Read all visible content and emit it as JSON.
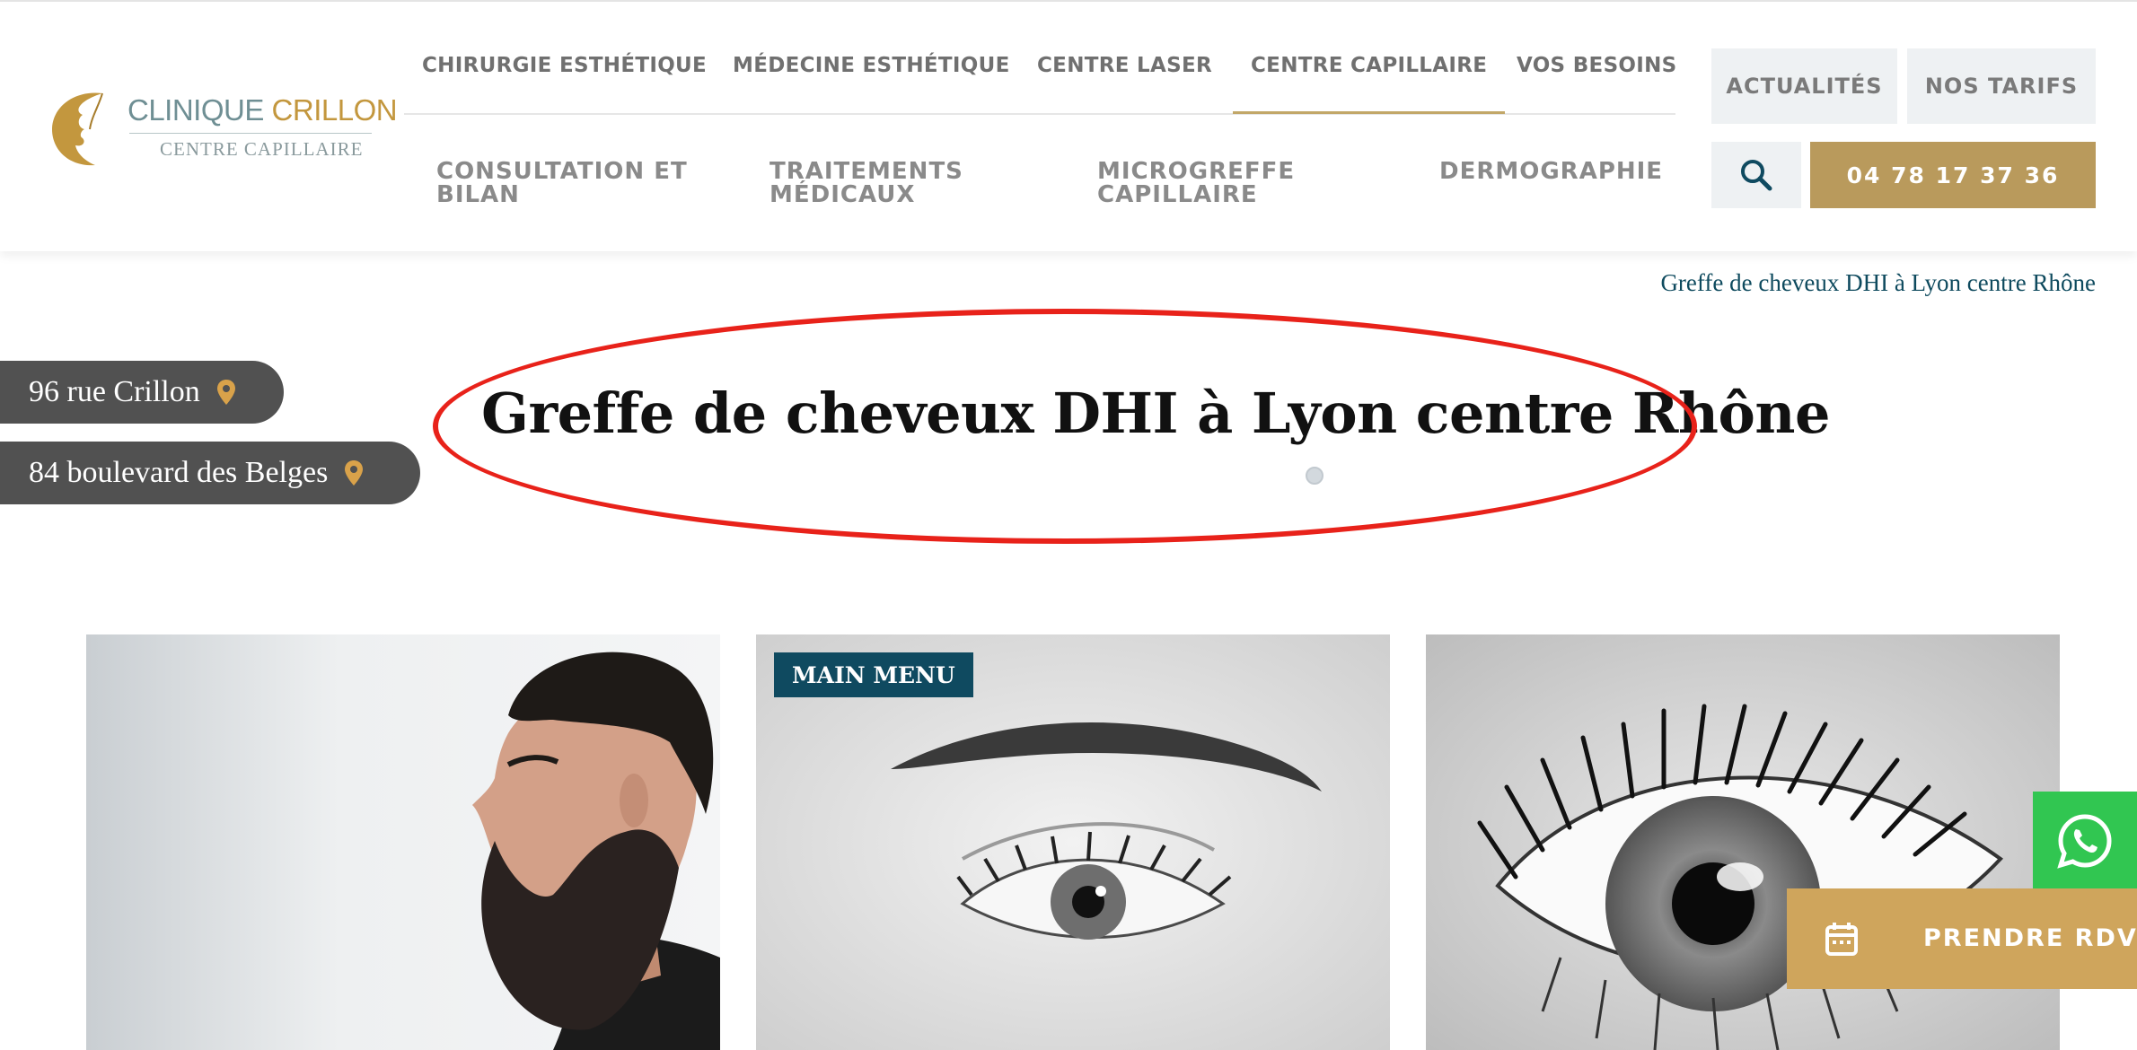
{
  "logo": {
    "name_part1": "CLINIQUE ",
    "name_part2": "CRILLON",
    "subtitle": "CENTRE CAPILLAIRE"
  },
  "nav_top": [
    {
      "label": "CHIRURGIE ESTHÉTIQUE"
    },
    {
      "label": "MÉDECINE ESTHÉTIQUE"
    },
    {
      "label": "CENTRE LASER"
    },
    {
      "label": "CENTRE CAPILLAIRE",
      "active": true
    },
    {
      "label": "VOS BESOINS"
    }
  ],
  "nav_sub": [
    {
      "line1": "CONSULTATION ET",
      "line2": "BILAN"
    },
    {
      "line1": "TRAITEMENTS",
      "line2": "MÉDICAUX"
    },
    {
      "line1": "MICROGREFFE",
      "line2": "CAPILLAIRE"
    },
    {
      "line1": "DERMOGRAPHIE",
      "line2": ""
    }
  ],
  "header_buttons": {
    "news": "ACTUALITÉS",
    "prices": "NOS TARIFS",
    "phone": "04 78 17 37 36",
    "search_icon": "search-icon"
  },
  "breadcrumb": "Greffe de cheveux DHI à Lyon centre Rhône",
  "addresses": [
    {
      "label": "96 rue Crillon",
      "icon": "map-pin-icon"
    },
    {
      "label": "84 boulevard des Belges",
      "icon": "map-pin-icon"
    }
  ],
  "page_title": "Greffe de cheveux DHI à Lyon centre Rhône",
  "cards": [
    {
      "image": "bearded-man-profile"
    },
    {
      "image": "eye-with-eyebrow",
      "badge": "MAIN MENU"
    },
    {
      "image": "eye-with-eyelashes"
    }
  ],
  "floating": {
    "whatsapp_icon": "whatsapp-icon",
    "rdv_label": "PRENDRE RDV",
    "rdv_icon": "calendar-icon"
  },
  "colors": {
    "gold": "#b99a5c",
    "teal": "#0f4a60",
    "annotation_red": "#e8221a",
    "whatsapp_green": "#31c651"
  }
}
